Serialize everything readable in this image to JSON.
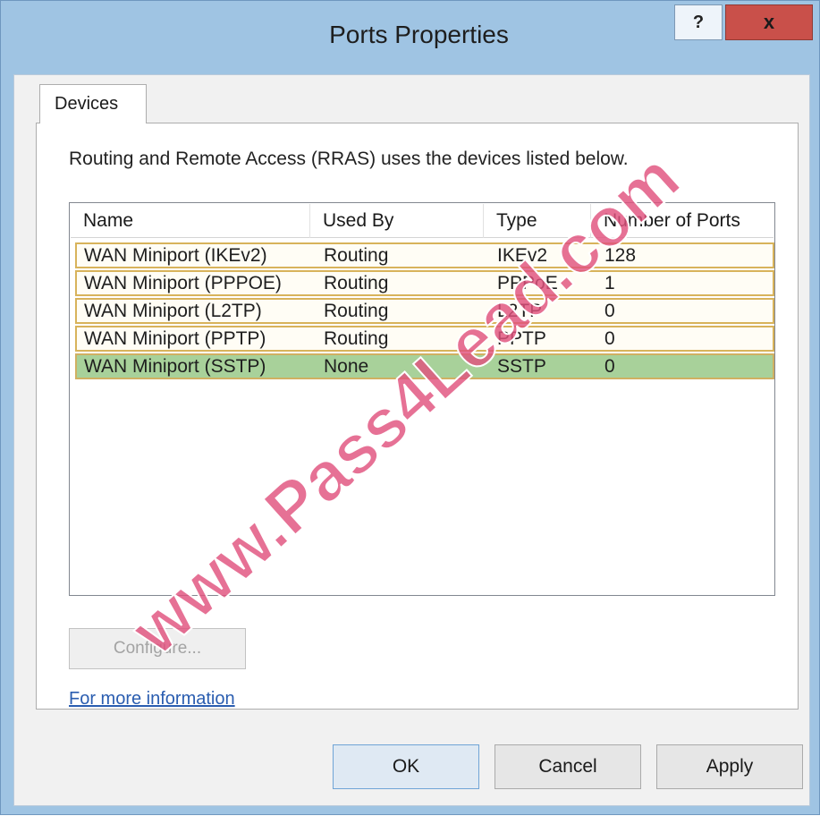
{
  "window": {
    "title": "Ports Properties",
    "help_label": "?",
    "close_label": "x"
  },
  "tabs": [
    {
      "label": "Devices"
    }
  ],
  "description": "Routing and Remote Access (RRAS) uses the devices listed below.",
  "device_list": {
    "columns": [
      "Name",
      "Used By",
      "Type",
      "Number of Ports"
    ],
    "rows": [
      {
        "name": "WAN Miniport (IKEv2)",
        "used_by": "Routing",
        "type": "IKEv2",
        "ports": "128"
      },
      {
        "name": "WAN Miniport (PPPOE)",
        "used_by": "Routing",
        "type": "PPPoE",
        "ports": "1"
      },
      {
        "name": "WAN Miniport (L2TP)",
        "used_by": "Routing",
        "type": "L2TP",
        "ports": "0"
      },
      {
        "name": "WAN Miniport (PPTP)",
        "used_by": "Routing",
        "type": "PPTP",
        "ports": "0"
      },
      {
        "name": "WAN Miniport (SSTP)",
        "used_by": "None",
        "type": "SSTP",
        "ports": "0"
      }
    ],
    "selected_row": 4
  },
  "configure_label": "Configure...",
  "more_info_link": "For more information",
  "buttons": {
    "ok": "OK",
    "cancel": "Cancel",
    "apply": "Apply"
  },
  "watermark": "www.Pass4Lead.com",
  "colors": {
    "title_bar": "#9fc4e3",
    "close_button": "#c9504a",
    "selected_row": "#a8d19a",
    "row_highlight_border": "#d8b35b",
    "link": "#2a5db0",
    "watermark": "#e0527e"
  }
}
